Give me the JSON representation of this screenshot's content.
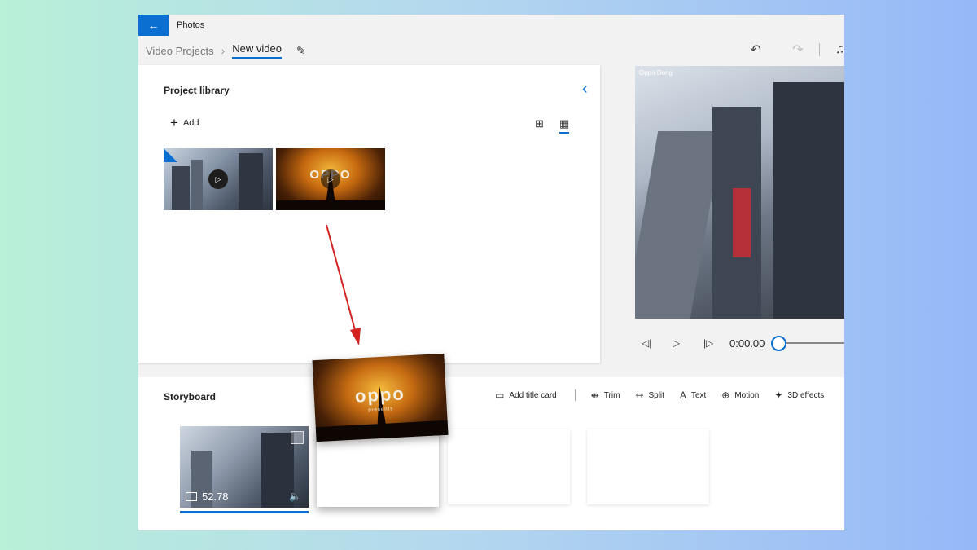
{
  "window": {
    "app_title": "Photos",
    "back_icon": "←",
    "breadcrumb": {
      "parent": "Video Projects",
      "separator": "›",
      "current": "New video"
    },
    "edit_icon": "✎"
  },
  "toolbar": {
    "undo_icon": "↶",
    "redo_icon": "↷",
    "music_icon": "♫"
  },
  "library": {
    "title": "Project library",
    "add_label": "Add",
    "add_icon": "+",
    "collapse_icon": "‹",
    "view_small_icon": "⊞",
    "view_large_icon": "▦",
    "thumbnails": [
      {
        "name": "city-video",
        "selected": true,
        "play_icon": "▷"
      },
      {
        "name": "oppo-intro",
        "selected": false,
        "play_icon": "▷",
        "overlay_text": "OPPO"
      }
    ]
  },
  "preview": {
    "watermark": "Oppo Dong",
    "prev_icon": "◁|",
    "play_icon": "▷",
    "next_icon": "|▷",
    "time": "0:00.00",
    "progress": 0
  },
  "storyboard": {
    "title": "Storyboard",
    "tools": [
      {
        "icon": "▭",
        "label": "Add title card"
      },
      {
        "icon": "⇹",
        "label": "Trim"
      },
      {
        "icon": "⇿",
        "label": "Split"
      },
      {
        "icon": "A",
        "label": "Text"
      },
      {
        "icon": "⊕",
        "label": "Motion"
      },
      {
        "icon": "✦",
        "label": "3D effects"
      }
    ],
    "clips": [
      {
        "duration": "52.78",
        "audio_icon": "🔈"
      }
    ]
  },
  "drag_card": {
    "text": "oppo",
    "subtitle": "presents"
  },
  "colors": {
    "accent": "#0a6fd1",
    "arrow": "#d32222"
  }
}
